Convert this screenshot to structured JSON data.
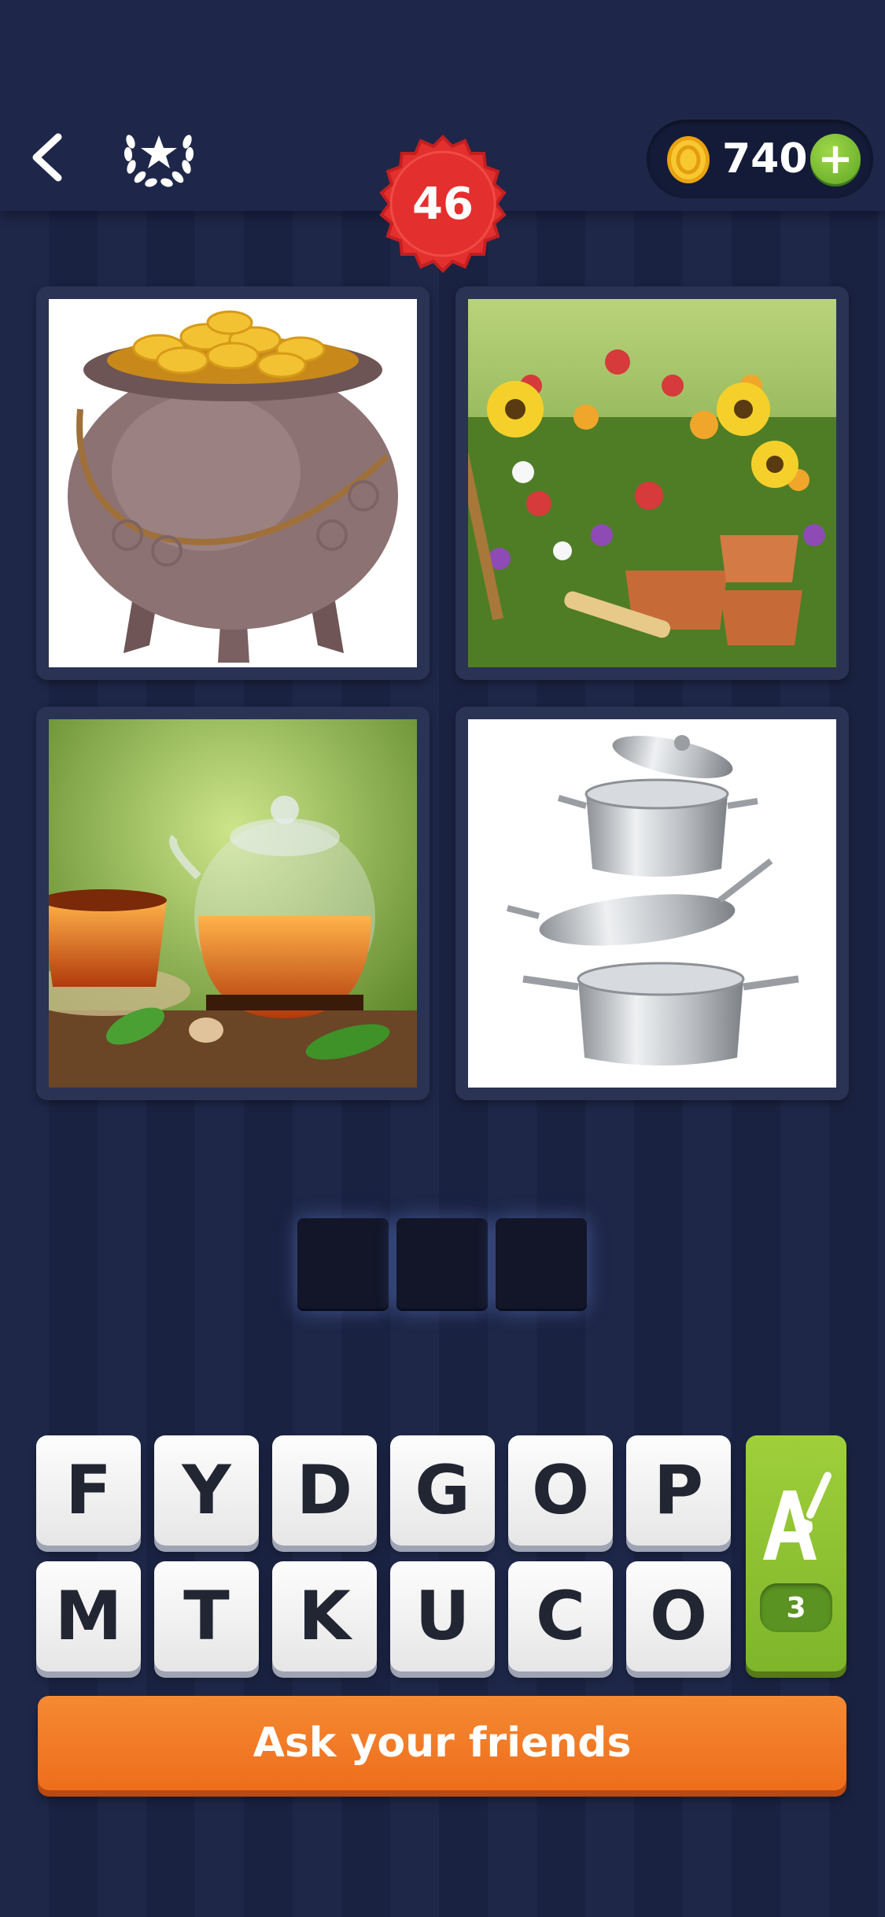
{
  "header": {
    "level": "46",
    "coins": "740",
    "icons": {
      "back": "chevron-left-icon",
      "achievements": "laurel-star-icon",
      "coin": "coin-icon",
      "add_coins": "plus-icon"
    }
  },
  "puzzle": {
    "images": [
      {
        "subject": "pot-of-gold"
      },
      {
        "subject": "flowers-and-flower-pots"
      },
      {
        "subject": "teapot-and-tea"
      },
      {
        "subject": "cooking-pots"
      }
    ],
    "answer_slots": 3
  },
  "keyboard": {
    "letters": [
      "F",
      "Y",
      "D",
      "G",
      "O",
      "P",
      "M",
      "T",
      "K",
      "U",
      "C",
      "O"
    ],
    "hint": {
      "icon": "paintbrush-letter-icon",
      "count": "3"
    }
  },
  "cta": {
    "label": "Ask your friends"
  },
  "colors": {
    "background": "#1d2647",
    "level_badge": "#e3302e",
    "coin_gold": "#f6c022",
    "plus_green": "#7bc23a",
    "hint_green": "#8cc234",
    "cta_orange": "#f27b25"
  }
}
